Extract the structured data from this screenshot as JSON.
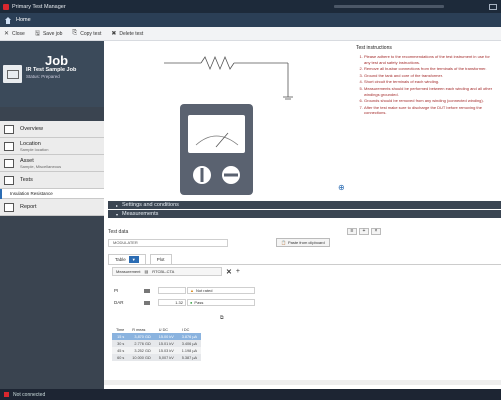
{
  "titlebar": {
    "title": "Primary Test Manager"
  },
  "homebar": {
    "label": "Home"
  },
  "toolbar": {
    "items": [
      {
        "icon": "✕",
        "label": "Close"
      },
      {
        "icon": "🖫",
        "label": "Save job"
      },
      {
        "icon": "⎘",
        "label": "Copy test"
      },
      {
        "icon": "✖",
        "label": "Delete test"
      }
    ]
  },
  "sidebar": {
    "job_title": "Job",
    "job_name": "IR Test Sample Job",
    "job_status": "Status: Prepared",
    "items": [
      {
        "label": "Overview",
        "sub": ""
      },
      {
        "label": "Location",
        "sub": "Sample location"
      },
      {
        "label": "Asset",
        "sub": "Sample, Miscellaneous"
      },
      {
        "label": "Tests",
        "sub": ""
      },
      {
        "label": "Insulation Resistance",
        "sub": ""
      },
      {
        "label": "Report",
        "sub": ""
      }
    ]
  },
  "instructions": {
    "heading": "Test instructions",
    "steps": [
      "Please adhere to the recommendations of the test instrument in use for any test and safety instructions.",
      "Remove all busbar connections from the terminals of the transformer.",
      "Ground the tank and core of the transformer.",
      "Short circuit the terminals of each winding.",
      "Measurements should be performed between each winding and all other windings grounded.",
      "Grounds should be removed from any winding (connected winding).",
      "After the test make sure to discharge the DUT before removing the connections."
    ]
  },
  "sections": {
    "settings": "Settings and conditions",
    "measurements": "Measurements"
  },
  "testdata": {
    "label": "Test data",
    "field": "MODULATER",
    "paste_button": "Paste from clipboard"
  },
  "tabs": {
    "table": "Table",
    "plot": "Plot"
  },
  "measurement": {
    "label": "Measurement",
    "value": "RTCBL-CTA"
  },
  "params": [
    {
      "name": "PI",
      "value": "",
      "status": "Not rated",
      "status_kind": "warn"
    },
    {
      "name": "DAR",
      "value": "1.32",
      "status": "Pass",
      "status_kind": "pass"
    }
  ],
  "results": {
    "headers": [
      "Time",
      "R meas",
      "U DC",
      "I DC"
    ],
    "rows": [
      [
        "15 s",
        "3,870 GΩ",
        "15.00 kV",
        "3.876 µA"
      ],
      [
        "30 s",
        "2.776 GΩ",
        "15.01 kV",
        "3.406 µA"
      ],
      [
        "45 s",
        "3.252 GΩ",
        "15.03 kV",
        "1.198 µA"
      ],
      [
        "60 s",
        "10.000 GΩ",
        "5,007 kV",
        "5.387 µA"
      ]
    ]
  },
  "statusbar": {
    "text": "Not connected"
  }
}
